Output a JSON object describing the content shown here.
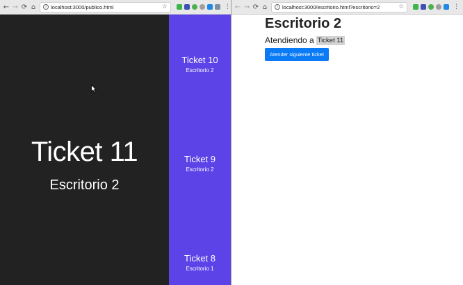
{
  "left_window": {
    "url": "localhost:3000/publico.html",
    "current": {
      "ticket": "Ticket 11",
      "desk": "Escritorio 2"
    },
    "queue": [
      {
        "ticket": "Ticket 10",
        "desk": "Escritorio 2"
      },
      {
        "ticket": "Ticket 9",
        "desk": "Escritorio 2"
      },
      {
        "ticket": "Ticket 8",
        "desk": "Escritorio 1"
      }
    ],
    "colors": {
      "background": "#222222",
      "queue_background": "#5b43e8"
    }
  },
  "right_window": {
    "url": "localhost:3000/escritorio.html?escritorio=2",
    "title": "Escritorio 2",
    "attending_label": "Atendiendo a",
    "attending_ticket": "Ticket 11",
    "next_button_label": "Atender siguiente ticket",
    "colors": {
      "button": "#0a7af5"
    }
  },
  "chrome_glyphs": {
    "back": "←",
    "forward": "→",
    "reload": "⟳",
    "home": "⌂",
    "info": "i",
    "star": "☆",
    "menu": "⋮"
  }
}
